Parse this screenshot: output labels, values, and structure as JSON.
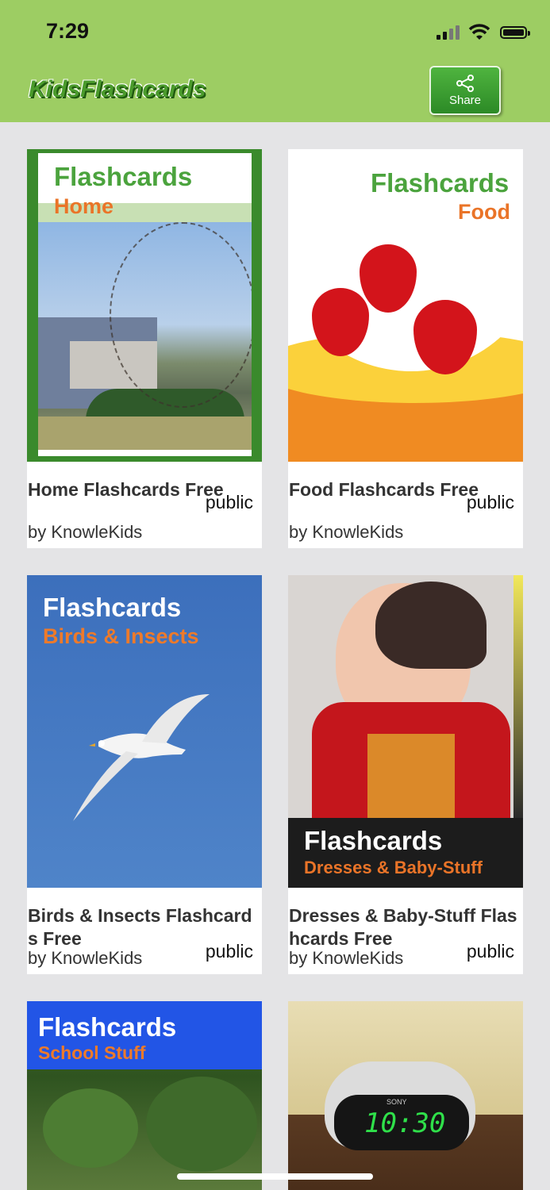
{
  "status_bar": {
    "time": "7:29"
  },
  "header": {
    "logo_part1": "KidsF",
    "logo_part2": "lashcards",
    "share_label": "Share"
  },
  "cards": [
    {
      "thumb_title": "Flashcards",
      "thumb_subtitle": "Home",
      "title": "Home Flashcards Free",
      "visibility": "public",
      "author": "by KnowleKids"
    },
    {
      "thumb_title": "Flashcards",
      "thumb_subtitle": "Food",
      "title": "Food Flashcards Free",
      "visibility": "public",
      "author": "by KnowleKids"
    },
    {
      "thumb_title": "Flashcards",
      "thumb_subtitle": "Birds & Insects",
      "title": "Birds & Insects Flashcards Free",
      "visibility": "public",
      "author": "by KnowleKids"
    },
    {
      "thumb_title": "Flashcards",
      "thumb_subtitle": "Dresses & Baby-Stuff",
      "title": "Dresses & Baby-Stuff Flashcards Free",
      "visibility": "public",
      "author": "by KnowleKids"
    },
    {
      "thumb_title": "Flashcards",
      "thumb_subtitle": "School Stuff"
    },
    {
      "clock_text": "10:30",
      "brand": "SONY"
    }
  ],
  "colors": {
    "header": "#9dcd63",
    "accent_green": "#4b9b2c",
    "accent_orange": "#f07c1e",
    "background": "#e4e4e6"
  }
}
